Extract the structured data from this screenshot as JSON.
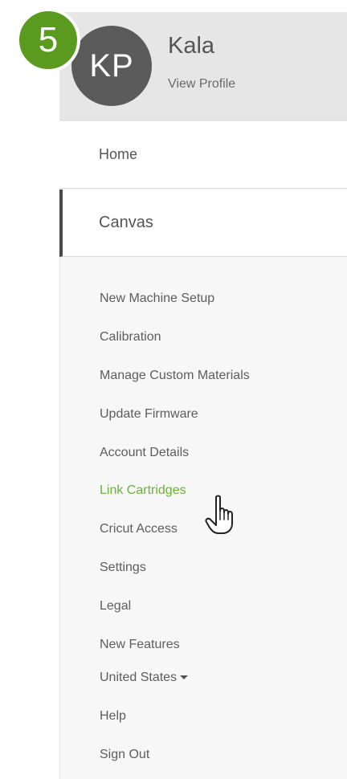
{
  "step": "5",
  "user": {
    "initials": "KP",
    "name": "Kala",
    "view_profile": "View Profile"
  },
  "nav": {
    "home": "Home",
    "canvas": "Canvas"
  },
  "menu": [
    "New Machine Setup",
    "Calibration",
    "Manage Custom Materials",
    "Update Firmware",
    "Account Details",
    "Link Cartridges",
    "Cricut Access",
    "Settings",
    "Legal",
    "New Features",
    "United States",
    "Help",
    "Sign Out"
  ],
  "icons": [
    "caret-down-icon",
    "hand-pointer-icon"
  ],
  "colors": {
    "accent": "#6bb33c",
    "badge": "#5a9a1f",
    "avatar": "#5b5b5b"
  }
}
